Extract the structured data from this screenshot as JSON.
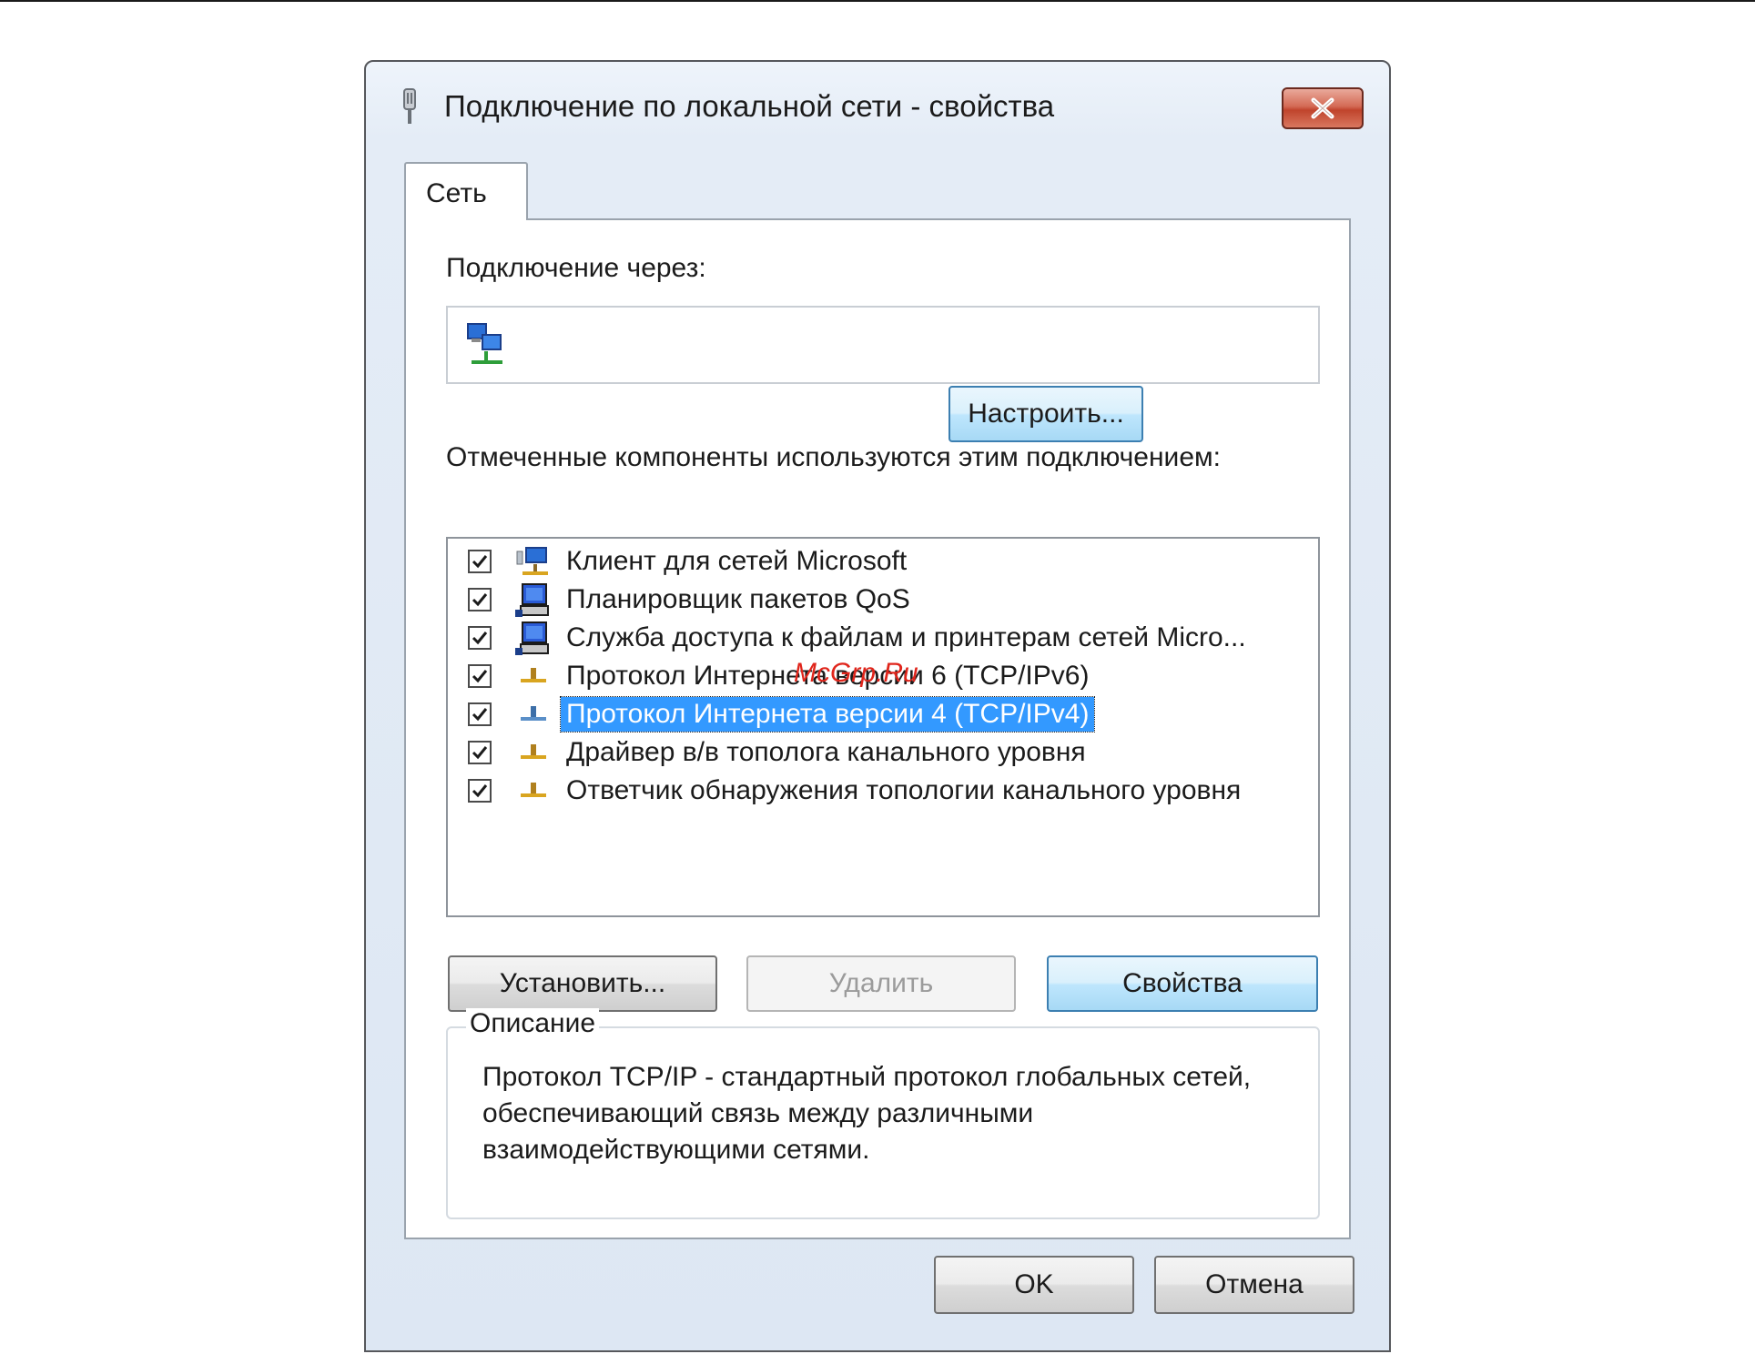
{
  "window": {
    "title": "Подключение по локальной сети - свойства",
    "close_label": "×"
  },
  "tabs": [
    {
      "label": "Сеть",
      "active": true
    }
  ],
  "connect_via": {
    "label": "Подключение через:",
    "value": ""
  },
  "configure_button": {
    "label": "Настроить..."
  },
  "components": {
    "label": "Отмеченные компоненты используются этим подключением:",
    "items": [
      {
        "label": "Клиент для сетей Microsoft",
        "checked": true,
        "icon": "network-client-icon"
      },
      {
        "label": "Планировщик пакетов QoS",
        "checked": true,
        "icon": "network-service-icon"
      },
      {
        "label": "Служба доступа к файлам и принтерам сетей Micro...",
        "checked": true,
        "icon": "network-service-icon"
      },
      {
        "label": "Протокол Интернета версии 6 (TCP/IPv6)",
        "checked": true,
        "icon": "protocol-icon"
      },
      {
        "label": "Протокол Интернета версии 4 (TCP/IPv4)",
        "checked": true,
        "icon": "protocol-icon",
        "selected": true
      },
      {
        "label": "Драйвер в/в тополога канального уровня",
        "checked": true,
        "icon": "protocol-icon"
      },
      {
        "label": "Ответчик обнаружения топологии канального уровня",
        "checked": true,
        "icon": "protocol-icon"
      }
    ]
  },
  "actions": {
    "install": "Установить...",
    "remove": "Удалить",
    "properties": "Свойства"
  },
  "description": {
    "title": "Описание",
    "text": "Протокол TCP/IP - стандартный протокол глобальных сетей, обеспечивающий связь между различными взаимодействующими сетями."
  },
  "footer": {
    "ok": "OK",
    "cancel": "Отмена"
  },
  "watermark": "McGrp.Ru",
  "colors": {
    "selection": "#3399ff",
    "close_button": "#c0442c",
    "focus_border": "#3c7fb1"
  }
}
